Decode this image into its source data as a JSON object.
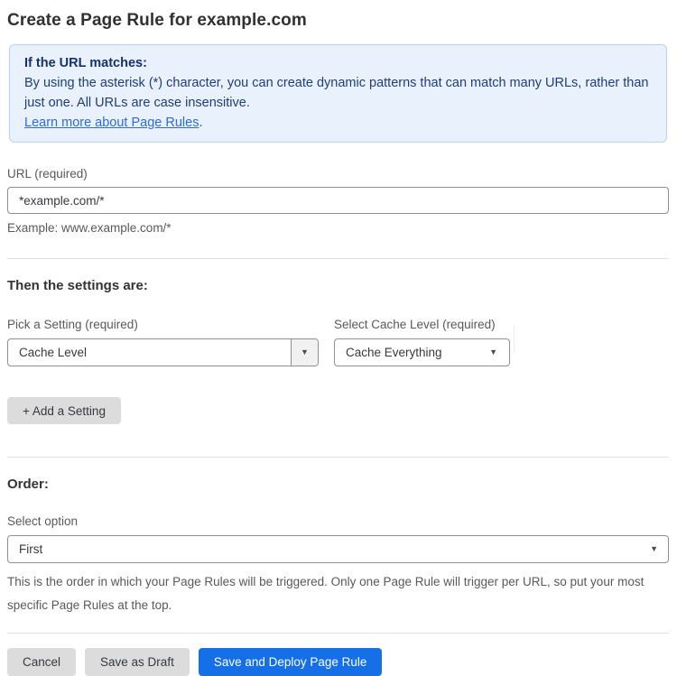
{
  "page": {
    "title": "Create a Page Rule for example.com"
  },
  "info_box": {
    "heading": "If the URL matches:",
    "body": "By using the asterisk (*) character, you can create dynamic patterns that can match many URLs, rather than just one. All URLs are case insensitive.",
    "link_label": "Learn more about Page Rules",
    "link_suffix": "."
  },
  "url_field": {
    "label": "URL (required)",
    "value": "*example.com/*",
    "helper": "Example: www.example.com/*"
  },
  "settings_section": {
    "heading": "Then the settings are:",
    "setting_picker": {
      "label": "Pick a Setting (required)",
      "value": "Cache Level"
    },
    "cache_level_picker": {
      "label": "Select Cache Level (required)",
      "value": "Cache Everything"
    },
    "add_setting_label": "+ Add a Setting"
  },
  "order_section": {
    "heading": "Order:",
    "select_label": "Select option",
    "value": "First",
    "helper": "This is the order in which your Page Rules will be triggered. Only one Page Rule will trigger per URL, so put your most specific Page Rules at the top."
  },
  "footer": {
    "cancel_label": "Cancel",
    "save_draft_label": "Save as Draft",
    "save_deploy_label": "Save and Deploy Page Rule"
  },
  "icons": {
    "dropdown_arrow": "▼"
  },
  "colors": {
    "accent_blue": "#1570e8",
    "info_box_bg": "#e9f2fc",
    "info_box_border": "#b5d3f0",
    "info_text": "#1f3d78",
    "link_blue": "#2f6bd8",
    "button_gray": "#dcdcdc",
    "label_gray": "#595959"
  }
}
